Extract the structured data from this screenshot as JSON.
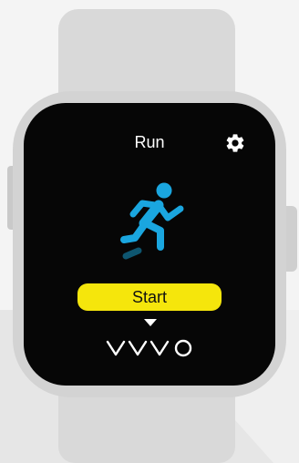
{
  "app": {
    "title": "Run",
    "settings_icon": "gear-icon",
    "activity_icon": "running-person-icon",
    "start_label": "Start",
    "more_icon": "chevron-down-icon",
    "brand": "vyvo"
  },
  "colors": {
    "screen": "#060606",
    "accent_icon": "#1aa6df",
    "icon_shadow": "#0e5670",
    "start_button": "#f5e60c",
    "watch_case": "#d3d3d3",
    "strap": "#d9d9d9"
  }
}
